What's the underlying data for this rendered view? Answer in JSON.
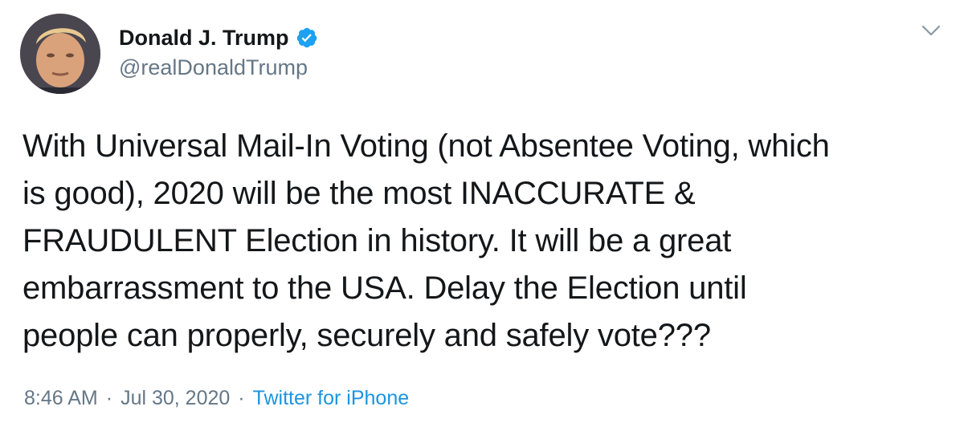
{
  "author": {
    "name": "Donald J. Trump",
    "handle": "@realDonaldTrump",
    "verified": true,
    "avatar_icon": "profile-photo"
  },
  "tweet": {
    "text": "With Universal Mail-In Voting (not Absentee Voting, which\nis good), 2020 will be the most INACCURATE &\nFRAUDULENT Election in history. It will be a great\nembarrassment to the USA. Delay the Election until\npeople can properly, securely and safely vote???"
  },
  "meta": {
    "time": "8:46 AM",
    "separator": "·",
    "date": "Jul 30, 2020",
    "source": "Twitter for iPhone"
  },
  "icons": {
    "menu": "chevron-down-icon",
    "verified": "verified-badge-icon"
  },
  "colors": {
    "text": "#14171a",
    "secondary": "#657786",
    "link": "#1b95e0",
    "verified_badge": "#1da1f2"
  }
}
